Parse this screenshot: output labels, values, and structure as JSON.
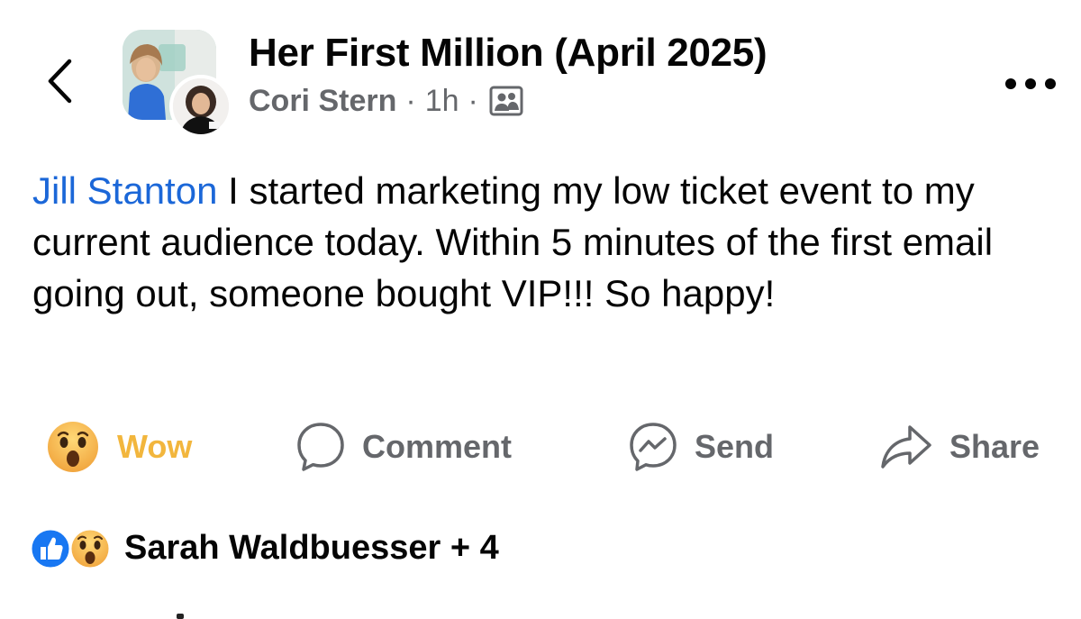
{
  "header": {
    "back_icon": "chevron-left-icon",
    "group_title": "Her First Million (April 2025)",
    "author": "Cori Stern",
    "separator": "·",
    "time": "1h",
    "privacy_icon": "group-members-icon",
    "more_icon": "more-horizontal-icon"
  },
  "post": {
    "mention": "Jill Stanton",
    "text": " I started marketing my low ticket event to my current audience today. Within 5 minutes of the first email going out, someone bought VIP!!! So happy!"
  },
  "actions": {
    "wow_label": "Wow",
    "comment_label": "Comment",
    "send_label": "Send",
    "share_label": "Share"
  },
  "reactions": {
    "icons": [
      "like-icon",
      "wow-icon"
    ],
    "summary": "Sarah Waldbuesser + 4"
  },
  "colors": {
    "mention": "#1b67d8",
    "wow": "#f2b63d",
    "secondary_text": "#65676b",
    "like_blue": "#1877f2"
  }
}
